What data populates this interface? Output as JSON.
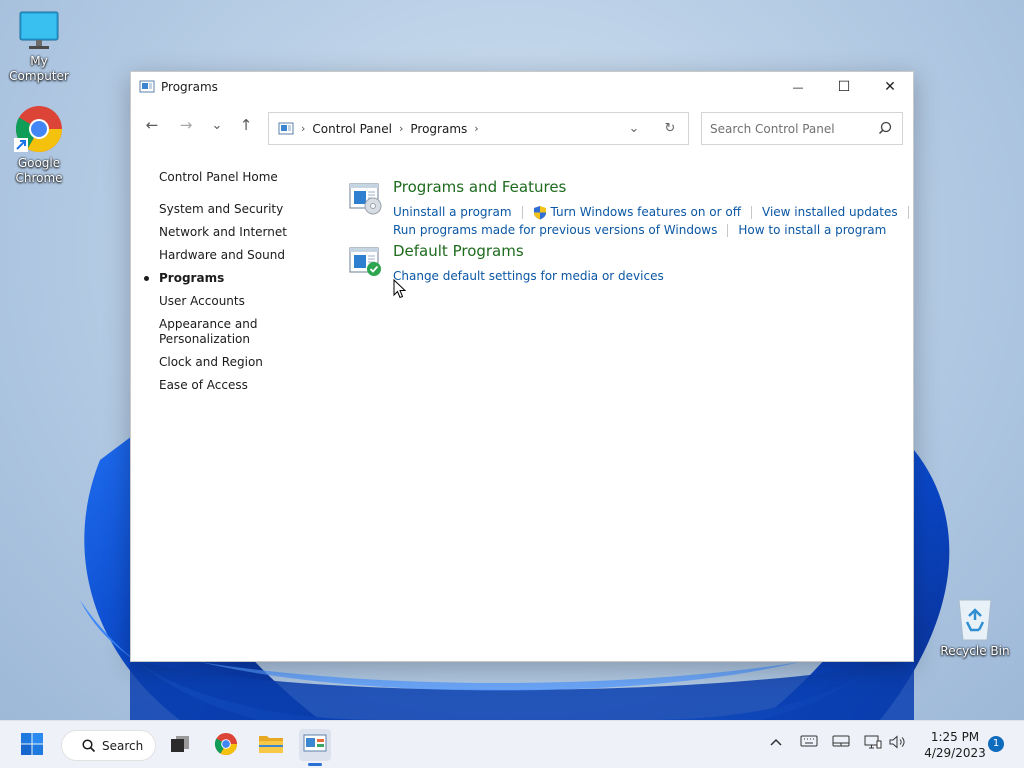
{
  "desktop": {
    "icons": [
      {
        "label": "My Computer",
        "icon": "monitor-icon"
      },
      {
        "label": "Google Chrome",
        "icon": "chrome-icon"
      },
      {
        "label": "Recycle Bin",
        "icon": "recycle-bin-icon"
      }
    ]
  },
  "window": {
    "title": "Programs",
    "controls": {
      "minimize": "—",
      "maximize": "☐",
      "close": "✕"
    }
  },
  "navigation": {
    "back": "←",
    "forward": "→",
    "recent": "⌄",
    "up": "↑",
    "breadcrumb": [
      "Control Panel",
      "Programs"
    ],
    "separator": "›",
    "dropdown": "⌄",
    "refresh": "↻"
  },
  "search": {
    "placeholder": "Search Control Panel",
    "value": ""
  },
  "leftnav": {
    "home": "Control Panel Home",
    "items": [
      "System and Security",
      "Network and Internet",
      "Hardware and Sound",
      "Programs",
      "User Accounts",
      "Appearance and Personalization",
      "Clock and Region",
      "Ease of Access"
    ],
    "active_index": 3
  },
  "sections": [
    {
      "heading": "Programs and Features",
      "icon": "programs-features-icon",
      "links_row1": [
        "Uninstall a program",
        "Turn Windows features on or off",
        "View installed updates"
      ],
      "links_row2": [
        "Run programs made for previous versions of Windows",
        "How to install a program"
      ]
    },
    {
      "heading": "Default Programs",
      "icon": "default-programs-icon",
      "links_row1": [
        "Change default settings for media or devices"
      ]
    }
  ],
  "taskbar": {
    "search_label": "Search",
    "time": "1:25 PM",
    "date": "4/29/2023",
    "notification_count": "1"
  },
  "colors": {
    "heading_green": "#1e6b1e",
    "link_blue": "#0b57a4",
    "accent": "#2a6fd6"
  }
}
